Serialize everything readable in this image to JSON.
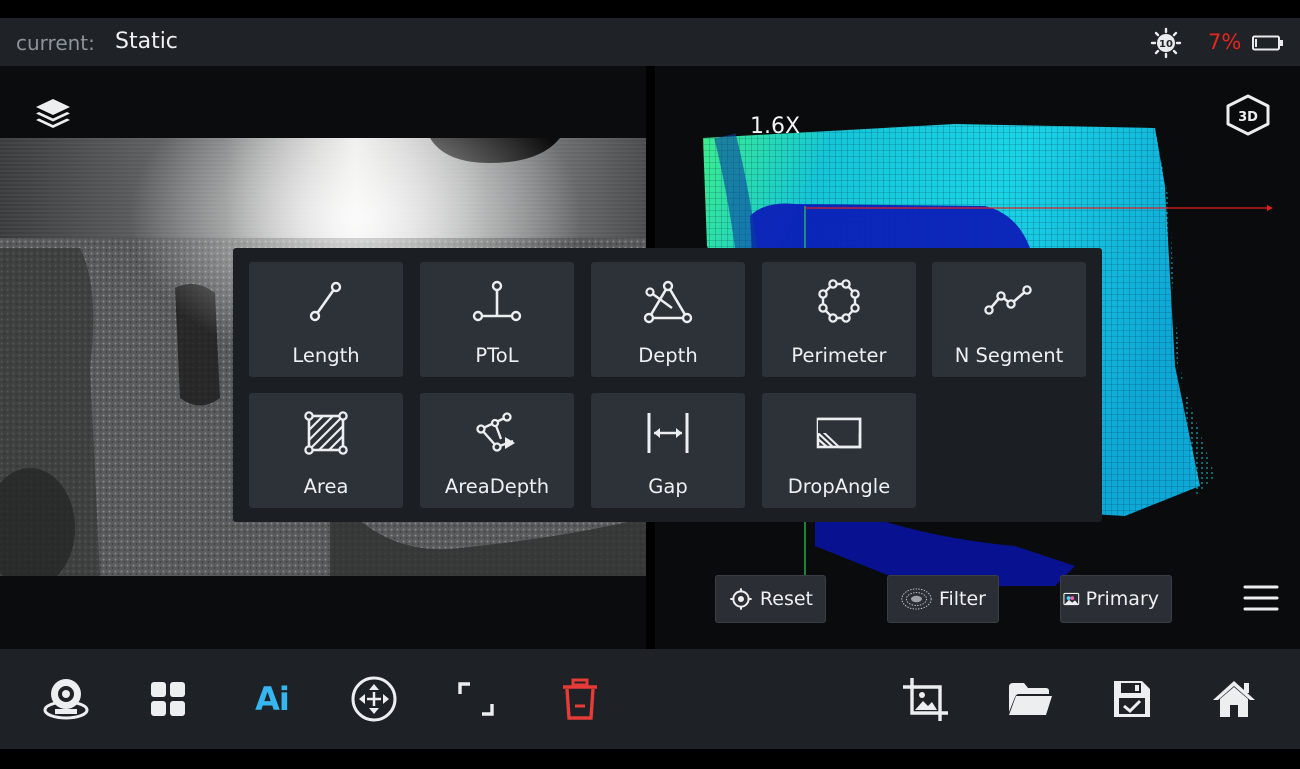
{
  "status_bar": {
    "mode_label": "current:",
    "mode_value": "Static",
    "brightness_level": "10",
    "battery_percent": "7%"
  },
  "left_view": {
    "layers_icon": "layers-icon"
  },
  "right_view": {
    "zoom": "1.6X",
    "view_3d_icon": "3d-cube-icon",
    "reset_label": "Reset",
    "filter_label": "Filter",
    "primary_label": "Primary"
  },
  "measure_menu": {
    "items": [
      {
        "label": "Length",
        "icon": "line-segment-icon"
      },
      {
        "label": "PToL",
        "icon": "point-to-line-icon"
      },
      {
        "label": "Depth",
        "icon": "depth-triangle-icon"
      },
      {
        "label": "Perimeter",
        "icon": "polygon-perimeter-icon"
      },
      {
        "label": "N Segment",
        "icon": "polyline-icon"
      },
      {
        "label": "Area",
        "icon": "area-icon"
      },
      {
        "label": "AreaDepth",
        "icon": "area-depth-icon"
      },
      {
        "label": "Gap",
        "icon": "gap-icon"
      },
      {
        "label": "DropAngle",
        "icon": "drop-angle-icon"
      }
    ]
  },
  "toolbar": {
    "ai_label": "Ai",
    "tools": [
      "camera-capture-icon",
      "grid-apps-icon",
      "ai-icon",
      "move-crosshair-icon",
      "fullscreen-icon",
      "delete-icon",
      "crop-image-icon",
      "folder-icon",
      "save-icon",
      "home-icon"
    ]
  },
  "colors": {
    "accent_blue": "#35b6f0",
    "battery_red": "#e8261e",
    "delete_red": "#e63b36"
  }
}
